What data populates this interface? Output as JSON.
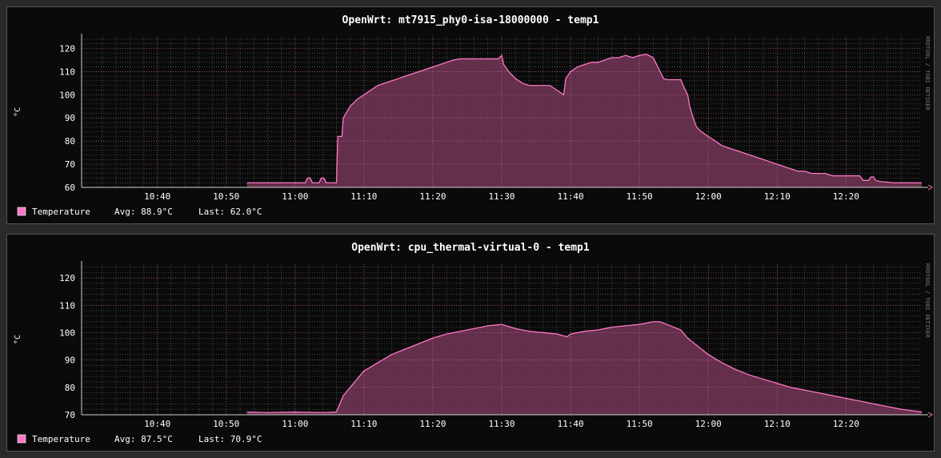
{
  "side_label": "RRDTOOL / TOBI OETIKER",
  "chart_data": [
    {
      "type": "area",
      "title": "OpenWrt: mt7915_phy0-isa-18000000 - temp1",
      "ylabel": "°C",
      "ylim": [
        60,
        125
      ],
      "yticks": [
        60,
        70,
        80,
        90,
        100,
        110,
        120
      ],
      "xlim": [
        629,
        751
      ],
      "xticks": [
        {
          "v": 640,
          "label": "10:40"
        },
        {
          "v": 650,
          "label": "10:50"
        },
        {
          "v": 660,
          "label": "11:00"
        },
        {
          "v": 670,
          "label": "11:10"
        },
        {
          "v": 680,
          "label": "11:20"
        },
        {
          "v": 690,
          "label": "11:30"
        },
        {
          "v": 700,
          "label": "11:40"
        },
        {
          "v": 710,
          "label": "11:50"
        },
        {
          "v": 720,
          "label": "12:00"
        },
        {
          "v": 730,
          "label": "12:10"
        },
        {
          "v": 740,
          "label": "12:20"
        }
      ],
      "grid": true,
      "series": [
        {
          "name": "Temperature",
          "color": "#ff77c8",
          "fill": "#6d3352",
          "avg": "Avg:  88.9°C",
          "last": "Last:  62.0°C",
          "points": [
            [
              653,
              62
            ],
            [
              655,
              62
            ],
            [
              660,
              62
            ],
            [
              661.5,
              62
            ],
            [
              661.8,
              64
            ],
            [
              662.2,
              64
            ],
            [
              662.5,
              62
            ],
            [
              663.5,
              62
            ],
            [
              663.8,
              64
            ],
            [
              664.2,
              64
            ],
            [
              664.5,
              62
            ],
            [
              666,
              62
            ],
            [
              666.2,
              82
            ],
            [
              666.8,
              82
            ],
            [
              667,
              90
            ],
            [
              668,
              95
            ],
            [
              669,
              98
            ],
            [
              670,
              100
            ],
            [
              671,
              102
            ],
            [
              672,
              104
            ],
            [
              673,
              105
            ],
            [
              674,
              106
            ],
            [
              675,
              107
            ],
            [
              676,
              108
            ],
            [
              677,
              109
            ],
            [
              678,
              110
            ],
            [
              679,
              111
            ],
            [
              680,
              112
            ],
            [
              681,
              113
            ],
            [
              682,
              114
            ],
            [
              683,
              115
            ],
            [
              684,
              115.5
            ],
            [
              686,
              115.5
            ],
            [
              688,
              115.5
            ],
            [
              689.5,
              115.5
            ],
            [
              690,
              117
            ],
            [
              690.3,
              113
            ],
            [
              691,
              110
            ],
            [
              692,
              107
            ],
            [
              693,
              105
            ],
            [
              694,
              104
            ],
            [
              696,
              104
            ],
            [
              697,
              104
            ],
            [
              697.5,
              103
            ],
            [
              698.5,
              101
            ],
            [
              699,
              100
            ],
            [
              699.3,
              107
            ],
            [
              700,
              110
            ],
            [
              701,
              112
            ],
            [
              702,
              113
            ],
            [
              703,
              114
            ],
            [
              704,
              114
            ],
            [
              705,
              115
            ],
            [
              706,
              116
            ],
            [
              707,
              116
            ],
            [
              708,
              117
            ],
            [
              709,
              116
            ],
            [
              710,
              117
            ],
            [
              711,
              117.5
            ],
            [
              712,
              116
            ],
            [
              712.5,
              113
            ],
            [
              713,
              110
            ],
            [
              713.5,
              107
            ],
            [
              714,
              106.5
            ],
            [
              715,
              106.5
            ],
            [
              716,
              106.5
            ],
            [
              716.5,
              103
            ],
            [
              717,
              100
            ],
            [
              717.3,
              95
            ],
            [
              717.8,
              90
            ],
            [
              718.3,
              86
            ],
            [
              719,
              84
            ],
            [
              720,
              82
            ],
            [
              721,
              80
            ],
            [
              722,
              78
            ],
            [
              723,
              77
            ],
            [
              724,
              76
            ],
            [
              725,
              75
            ],
            [
              726,
              74
            ],
            [
              727,
              73
            ],
            [
              728,
              72
            ],
            [
              729,
              71
            ],
            [
              730,
              70
            ],
            [
              731,
              69
            ],
            [
              732,
              68
            ],
            [
              733,
              67
            ],
            [
              734,
              67
            ],
            [
              735,
              66
            ],
            [
              736,
              66
            ],
            [
              737,
              66
            ],
            [
              738,
              65
            ],
            [
              740,
              65
            ],
            [
              742,
              65
            ],
            [
              742.5,
              63
            ],
            [
              743.3,
              63
            ],
            [
              743.6,
              64.5
            ],
            [
              744,
              64.5
            ],
            [
              744.3,
              63
            ],
            [
              745,
              62.5
            ],
            [
              747,
              62
            ],
            [
              751,
              62
            ]
          ]
        }
      ]
    },
    {
      "type": "area",
      "title": "OpenWrt: cpu_thermal-virtual-0 - temp1",
      "ylabel": "°C",
      "ylim": [
        70,
        125
      ],
      "yticks": [
        70,
        80,
        90,
        100,
        110,
        120
      ],
      "xlim": [
        629,
        751
      ],
      "xticks": [
        {
          "v": 640,
          "label": "10:40"
        },
        {
          "v": 650,
          "label": "10:50"
        },
        {
          "v": 660,
          "label": "11:00"
        },
        {
          "v": 670,
          "label": "11:10"
        },
        {
          "v": 680,
          "label": "11:20"
        },
        {
          "v": 690,
          "label": "11:30"
        },
        {
          "v": 700,
          "label": "11:40"
        },
        {
          "v": 710,
          "label": "11:50"
        },
        {
          "v": 720,
          "label": "12:00"
        },
        {
          "v": 730,
          "label": "12:10"
        },
        {
          "v": 740,
          "label": "12:20"
        }
      ],
      "grid": true,
      "series": [
        {
          "name": "Temperature",
          "color": "#ff77c8",
          "fill": "#6d3352",
          "avg": "Avg:  87.5°C",
          "last": "Last:  70.9°C",
          "points": [
            [
              653,
              71
            ],
            [
              656,
              70.8
            ],
            [
              660,
              71
            ],
            [
              664,
              70.8
            ],
            [
              666,
              71
            ],
            [
              667,
              77
            ],
            [
              668,
              80
            ],
            [
              669,
              83
            ],
            [
              670,
              86
            ],
            [
              672,
              89
            ],
            [
              674,
              92
            ],
            [
              676,
              94
            ],
            [
              678,
              96
            ],
            [
              680,
              98
            ],
            [
              682,
              99.5
            ],
            [
              684,
              100.5
            ],
            [
              686,
              101.5
            ],
            [
              688,
              102.5
            ],
            [
              690,
              103
            ],
            [
              692,
              101.5
            ],
            [
              694,
              100.5
            ],
            [
              696,
              100
            ],
            [
              698,
              99.5
            ],
            [
              699.5,
              98.5
            ],
            [
              700,
              99.5
            ],
            [
              702,
              100.5
            ],
            [
              704,
              101
            ],
            [
              706,
              102
            ],
            [
              708,
              102.5
            ],
            [
              710,
              103
            ],
            [
              712,
              104
            ],
            [
              713,
              104
            ],
            [
              714,
              103
            ],
            [
              716,
              101
            ],
            [
              717,
              98
            ],
            [
              718,
              96
            ],
            [
              720,
              92
            ],
            [
              722,
              89
            ],
            [
              724,
              86.5
            ],
            [
              726,
              84.5
            ],
            [
              728,
              83
            ],
            [
              730,
              81.5
            ],
            [
              732,
              80
            ],
            [
              734,
              79
            ],
            [
              736,
              78
            ],
            [
              738,
              77
            ],
            [
              740,
              76
            ],
            [
              742,
              75
            ],
            [
              744,
              74
            ],
            [
              746,
              73
            ],
            [
              748,
              72
            ],
            [
              751,
              71
            ]
          ]
        }
      ]
    }
  ]
}
